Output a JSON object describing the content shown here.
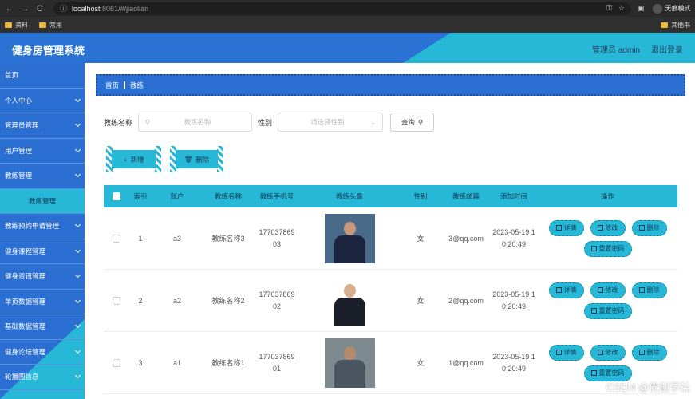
{
  "browser": {
    "back": "←",
    "forward": "→",
    "reload": "C",
    "info": "ⓘ",
    "host": "localhost",
    "path": ":8081/#/jiaolian",
    "key_icon": "key-icon",
    "star_icon": "star-icon",
    "sidebar_icon": "sidebar-icon",
    "profile_label": "无痕模式"
  },
  "bookmarks": {
    "items": [
      "资料",
      "常用"
    ],
    "other": "其他书"
  },
  "header": {
    "title": "健身房管理系统",
    "user": "管理员 admin",
    "logout": "退出登录"
  },
  "sidebar": {
    "items": [
      {
        "label": "首页",
        "chevron": false
      },
      {
        "label": "个人中心",
        "chevron": true
      },
      {
        "label": "管理员管理",
        "chevron": true
      },
      {
        "label": "用户管理",
        "chevron": true
      },
      {
        "label": "教练管理",
        "chevron": true
      },
      {
        "label": "教练管理",
        "sub": true
      },
      {
        "label": "教练预约申请管理",
        "chevron": true
      },
      {
        "label": "健身课程管理",
        "chevron": true
      },
      {
        "label": "健身资讯管理",
        "chevron": true
      },
      {
        "label": "单页数据管理",
        "chevron": true
      },
      {
        "label": "基础数据管理",
        "chevron": true
      },
      {
        "label": "健身论坛管理",
        "chevron": true
      },
      {
        "label": "轮播图信息",
        "chevron": true
      }
    ]
  },
  "breadcrumb": {
    "home": "首页",
    "current": "教练"
  },
  "search": {
    "name_label": "教练名称",
    "name_placeholder": "教练名称",
    "sex_label": "性别",
    "sex_placeholder": "请选择性别",
    "query_button": "查询"
  },
  "actions": {
    "add": "新增",
    "delete": "删除"
  },
  "table": {
    "headers": [
      "索引",
      "账户",
      "教练名称",
      "教练手机号",
      "教练头像",
      "性别",
      "教练邮箱",
      "添加时间",
      "操作"
    ],
    "rows": [
      {
        "index": "1",
        "account": "a3",
        "name": "教练名称3",
        "phone": "17703786903",
        "sex": "女",
        "email": "3@qq.com",
        "time": "2023-05-19 10:20:49"
      },
      {
        "index": "2",
        "account": "a2",
        "name": "教练名称2",
        "phone": "17703786902",
        "sex": "女",
        "email": "2@qq.com",
        "time": "2023-05-19 10:20:49"
      },
      {
        "index": "3",
        "account": "a1",
        "name": "教练名称1",
        "phone": "17703786901",
        "sex": "女",
        "email": "1@qq.com",
        "time": "2023-05-19 10:20:49"
      }
    ],
    "row_ops": [
      "详情",
      "修改",
      "删除",
      "重置密码"
    ]
  },
  "watermark": "CSDN @优创学社"
}
